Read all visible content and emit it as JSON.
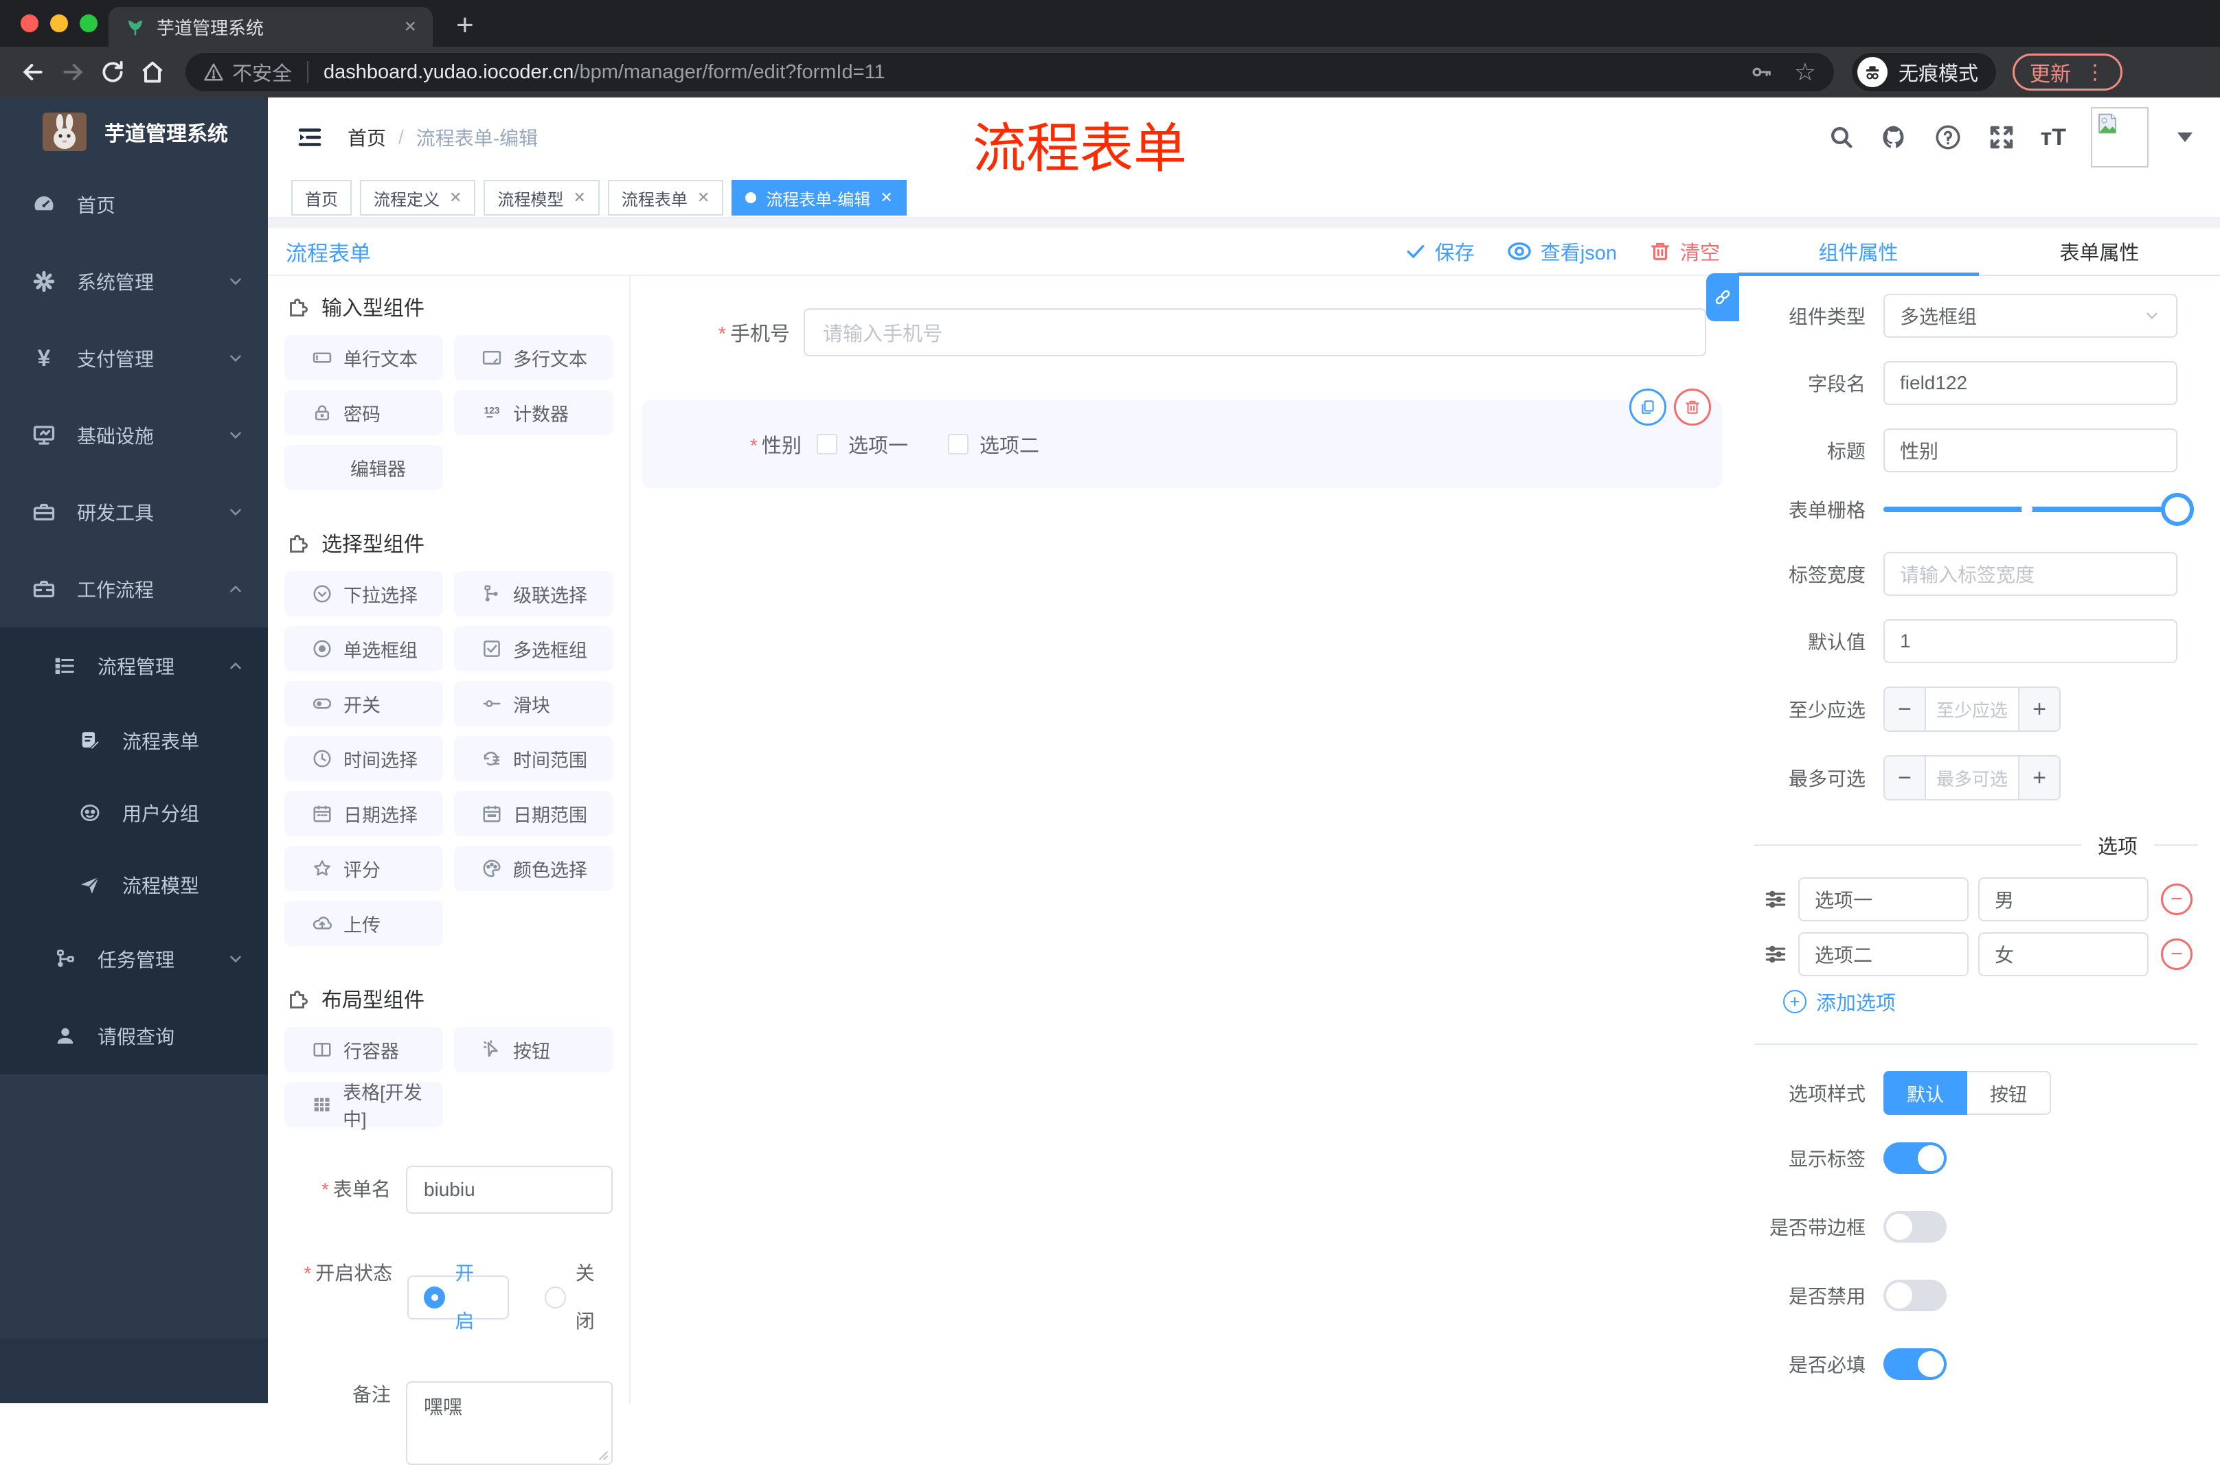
{
  "browser": {
    "tab_title": "芋道管理系统",
    "close_tab": "×",
    "new_tab": "+",
    "not_secure": "不安全",
    "url_host": "dashboard.yudao.iocoder.cn",
    "url_path": "/bpm/manager/form/edit?formId=11",
    "incognito_label": "无痕模式",
    "update_label": "更新",
    "menu_dots": "⋮"
  },
  "sidebar": {
    "title": "芋道管理系统",
    "items": [
      {
        "label": "首页"
      },
      {
        "label": "系统管理"
      },
      {
        "label": "支付管理"
      },
      {
        "label": "基础设施"
      },
      {
        "label": "研发工具"
      },
      {
        "label": "工作流程"
      },
      {
        "label": "流程管理"
      },
      {
        "label": "流程表单"
      },
      {
        "label": "用户分组"
      },
      {
        "label": "流程模型"
      },
      {
        "label": "任务管理"
      },
      {
        "label": "请假查询"
      }
    ]
  },
  "header": {
    "breadcrumb_home": "首页",
    "breadcrumb_sep": "/",
    "breadcrumb_current": "流程表单-编辑",
    "annotation": "流程表单"
  },
  "tabs": [
    {
      "label": "首页"
    },
    {
      "label": "流程定义"
    },
    {
      "label": "流程模型"
    },
    {
      "label": "流程表单"
    },
    {
      "label": "流程表单-编辑"
    }
  ],
  "toolbar": {
    "title": "流程表单",
    "save": "保存",
    "view_json": "查看json",
    "clear": "清空"
  },
  "palette": {
    "sections": [
      {
        "title": "输入型组件",
        "items": [
          {
            "label": "单行文本"
          },
          {
            "label": "多行文本"
          },
          {
            "label": "密码"
          },
          {
            "label": "计数器"
          },
          {
            "label": "编辑器"
          }
        ]
      },
      {
        "title": "选择型组件",
        "items": [
          {
            "label": "下拉选择"
          },
          {
            "label": "级联选择"
          },
          {
            "label": "单选框组"
          },
          {
            "label": "多选框组"
          },
          {
            "label": "开关"
          },
          {
            "label": "滑块"
          },
          {
            "label": "时间选择"
          },
          {
            "label": "时间范围"
          },
          {
            "label": "日期选择"
          },
          {
            "label": "日期范围"
          },
          {
            "label": "评分"
          },
          {
            "label": "颜色选择"
          },
          {
            "label": "上传"
          }
        ]
      },
      {
        "title": "布局型组件",
        "items": [
          {
            "label": "行容器"
          },
          {
            "label": "按钮"
          },
          {
            "label": "表格[开发中]"
          }
        ]
      }
    ],
    "form": {
      "name_label": "表单名",
      "name_value": "biubiu",
      "status_label": "开启状态",
      "status_on": "开启",
      "status_off": "关闭",
      "remark_label": "备注",
      "remark_value": "嘿嘿"
    }
  },
  "canvas": {
    "phone_label": "手机号",
    "phone_placeholder": "请输入手机号",
    "gender_label": "性别",
    "gender_option1": "选项一",
    "gender_option2": "选项二"
  },
  "panel": {
    "tab_component": "组件属性",
    "tab_form": "表单属性",
    "type_label": "组件类型",
    "type_value": "多选框组",
    "field_label": "字段名",
    "field_value": "field122",
    "title_label": "标题",
    "title_value": "性别",
    "grid_label": "表单栅格",
    "label_width_label": "标签宽度",
    "label_width_placeholder": "请输入标签宽度",
    "default_label": "默认值",
    "default_value": "1",
    "min_label": "至少应选",
    "min_placeholder": "至少应选",
    "max_label": "最多可选",
    "max_placeholder": "最多可选",
    "stepper_minus": "−",
    "stepper_plus": "+",
    "options_divider": "选项",
    "options": [
      {
        "label": "选项一",
        "value": "男"
      },
      {
        "label": "选项二",
        "value": "女"
      }
    ],
    "remove_option": "−",
    "add_option": "添加选项",
    "style_label": "选项样式",
    "style_default": "默认",
    "style_button": "按钮",
    "toggles": [
      {
        "label": "显示标签",
        "on": true
      },
      {
        "label": "是否带边框",
        "on": false
      },
      {
        "label": "是否禁用",
        "on": false
      },
      {
        "label": "是否必填",
        "on": true
      }
    ]
  },
  "colors": {
    "accent": "#409eff",
    "danger": "#f56c6c",
    "annotation": "#fe2b00"
  }
}
